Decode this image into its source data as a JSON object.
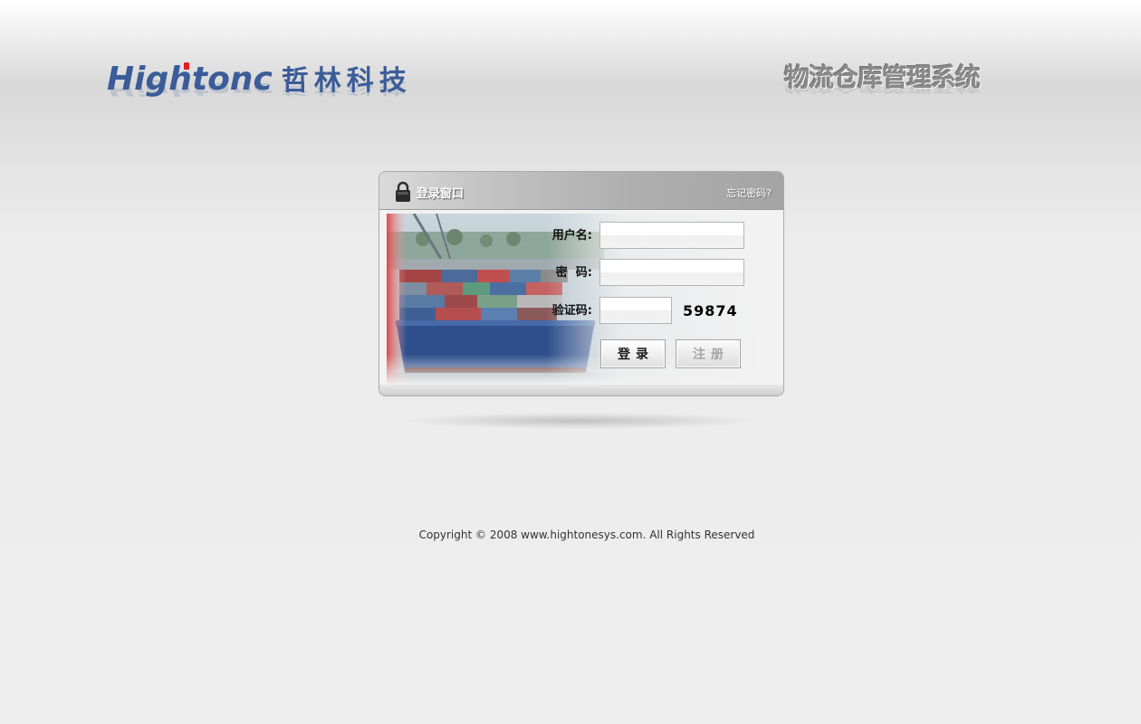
{
  "header": {
    "brand_latin": "Hightonc",
    "brand_cn": "哲林科技",
    "system_title": "物流仓库管理系统",
    "brand_color": "#3b5c98",
    "brand_accent": "#e02020"
  },
  "login": {
    "title": "登录窗口",
    "forgot_link": "忘记密码?",
    "username_label": "用户名:",
    "username_value": "",
    "password_label": "密  码:",
    "password_value": "",
    "captcha_label": "验证码:",
    "captcha_value": "",
    "captcha_code": "59874",
    "login_button": "登录",
    "register_button": "注册",
    "header_icon": "lock-icon",
    "photo": "container-ship-photo"
  },
  "footer": {
    "copyright": "Copyright © 2008 www.hightonesys.com. All Rights Reserved"
  }
}
